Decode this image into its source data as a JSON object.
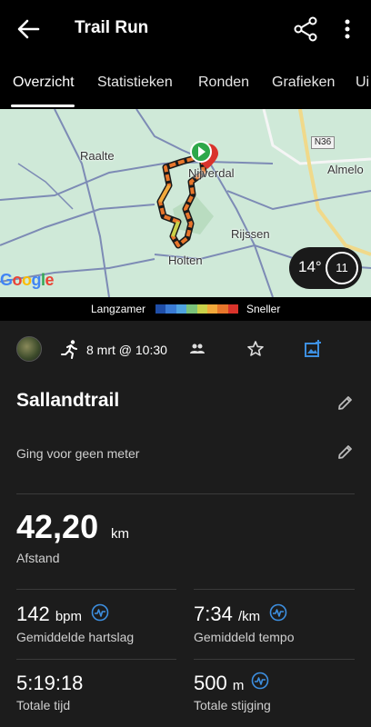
{
  "appbar": {
    "title": "Trail Run"
  },
  "tabs": [
    "Overzicht",
    "Statistieken",
    "Ronden",
    "Grafieken",
    "Ui"
  ],
  "map": {
    "towns": [
      "Raalte",
      "Nijverdal",
      "Almelo",
      "Rijssen",
      "Holten"
    ],
    "road": "N36",
    "attribution": "Google",
    "temperature": "14°",
    "wind": "11"
  },
  "legend": {
    "slower": "Langzamer",
    "faster": "Sneller",
    "colors": [
      "#1f4ea8",
      "#3a7bd5",
      "#4fa3e0",
      "#7ac27a",
      "#c9d14a",
      "#f2a93b",
      "#e8762b",
      "#d9332b"
    ]
  },
  "activity": {
    "date": "8 mrt @ 10:30",
    "name": "Sallandtrail",
    "description": "Ging voor geen meter",
    "distance": {
      "value": "42,20",
      "unit": "km",
      "label": "Afstand"
    },
    "heart_rate": {
      "value": "142",
      "unit": "bpm",
      "label": "Gemiddelde hartslag"
    },
    "pace": {
      "value": "7:34",
      "unit": "/km",
      "label": "Gemiddeld tempo"
    },
    "time": {
      "value": "5:19:18",
      "label": "Totale tijd"
    },
    "ascent": {
      "value": "500",
      "unit": "m",
      "label": "Totale stijging"
    }
  },
  "colors": {
    "accent": "#3d8fe0",
    "background": "#1c1c1c"
  }
}
